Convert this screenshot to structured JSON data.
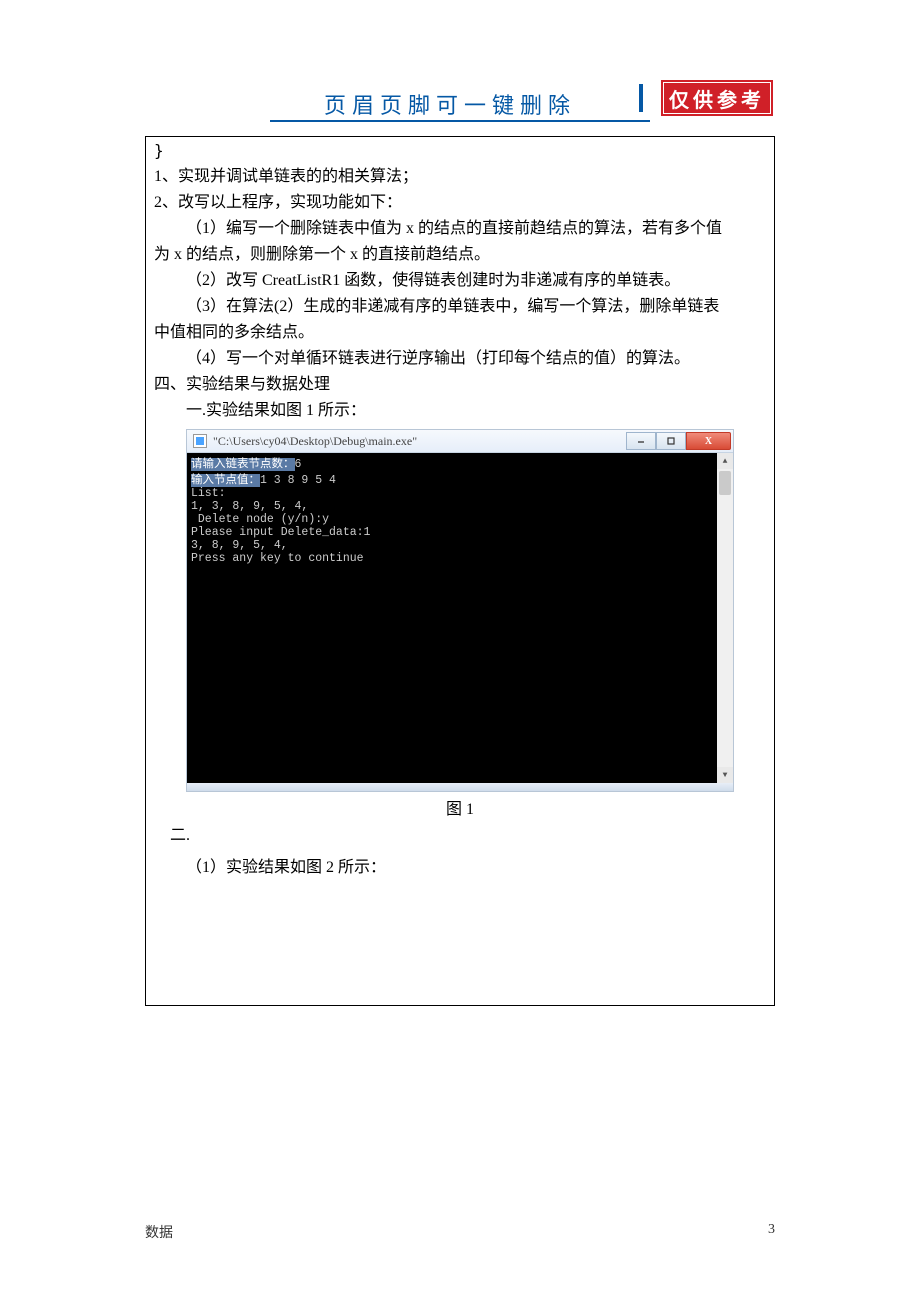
{
  "header": {
    "title": "页眉页脚可一键删除",
    "stamp": "仅供参考"
  },
  "body": {
    "brace": "}",
    "items": [
      "1、实现并调试单链表的的相关算法；",
      "2、改写以上程序，实现功能如下：",
      "（1）编写一个删除链表中值为 x 的结点的直接前趋结点的算法，若有多个值",
      "为 x 的结点，则删除第一个 x 的直接前趋结点。",
      "（2）改写 CreatListR1 函数，使得链表创建时为非递减有序的单链表。",
      "（3）在算法(2）生成的非递减有序的单链表中，编写一个算法，删除单链表",
      "中值相同的多余结点。",
      "（4）写一个对单循环链表进行逆序输出（打印每个结点的值）的算法。"
    ],
    "section4": "四、实验结果与数据处理",
    "fig1_note": "一.实验结果如图 1 所示：",
    "fig1_caption": "图 1",
    "section_two": "二.",
    "fig2_note": "（1）实验结果如图 2 所示："
  },
  "console": {
    "title": "\"C:\\Users\\cy04\\Desktop\\Debug\\main.exe\"",
    "btn_min": "—",
    "btn_max": "▢",
    "btn_close": "X",
    "lines": {
      "l1a": "请输入链表节点数：",
      "l1b": "6",
      "l2a": "输入节点值：",
      "l2b": "1 3 8 9 5 4",
      "l3": "List:",
      "l4": "1, 3, 8, 9, 5, 4,",
      "l5": " Delete node (y/n):y",
      "l6": "Please input Delete_data:1",
      "l7": "3, 8, 9, 5, 4,",
      "l8": "Press any key to continue"
    }
  },
  "footer": {
    "left": "数据",
    "page": "3"
  }
}
